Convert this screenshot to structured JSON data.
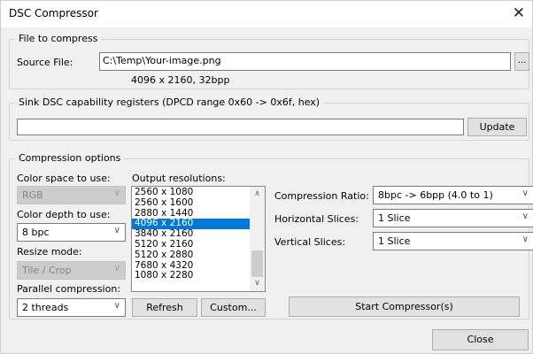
{
  "window": {
    "title": "DSC Compressor",
    "close_glyph": "✕"
  },
  "file_group": {
    "label": "File to compress",
    "source_label": "Source File:",
    "source_value": "C:\\Temp\\Your-image.png",
    "browse_label": "...",
    "info": "4096 x 2160, 32bpp"
  },
  "sink_group": {
    "label": "Sink DSC capability registers (DPCD range 0x60 -> 0x6f, hex)",
    "value": "",
    "update_label": "Update"
  },
  "compression_group": {
    "label": "Compression options",
    "color_space_label": "Color space to use:",
    "color_space_value": "RGB",
    "color_depth_label": "Color depth to use:",
    "color_depth_value": "8 bpc",
    "resize_mode_label": "Resize mode:",
    "resize_mode_value": "Tile / Crop",
    "parallel_label": "Parallel compression:",
    "parallel_value": "2 threads",
    "output_res_label": "Output resolutions:",
    "resolutions": [
      "2560 x 1080",
      "2560 x 1600",
      "2880 x 1440",
      "4096 x 2160",
      "3840 x 2160",
      "5120 x 2160",
      "5120 x 2880",
      "7680 x 4320",
      "1080 x 2280"
    ],
    "selected_resolution_index": 3,
    "refresh_label": "Refresh",
    "custom_label": "Custom...",
    "ratio_label": "Compression Ratio:",
    "ratio_value": "8bpc -> 6bpp (4.0 to 1)",
    "hslices_label": "Horizontal Slices:",
    "hslices_value": "1 Slice",
    "vslices_label": "Vertical Slices:",
    "vslices_value": "1 Slice",
    "start_label": "Start Compressor(s)"
  },
  "footer": {
    "close_label": "Close"
  },
  "icons": {
    "dropdown": "∨",
    "scroll_up": "∧",
    "scroll_down": "∨"
  },
  "colors": {
    "selection": "#0078d7",
    "disabled": "#cccccc"
  }
}
